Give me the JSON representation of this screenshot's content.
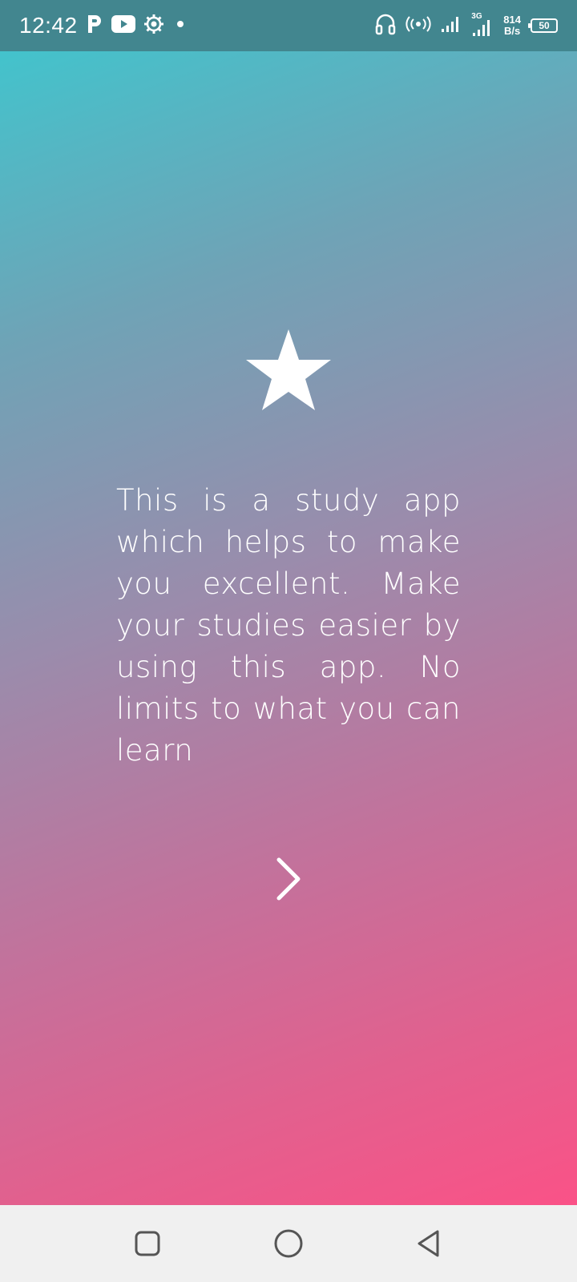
{
  "status_bar": {
    "time": "12:42",
    "network_speed_value": "814",
    "network_speed_unit": "B/s",
    "network_type": "3G",
    "battery_level": "50",
    "icons": [
      "parking-icon",
      "youtube-icon",
      "settings-gear-icon",
      "dot-icon",
      "headphones-icon",
      "hotspot-icon",
      "signal-icon",
      "signal-3g-icon",
      "battery-icon"
    ]
  },
  "intro": {
    "icon": "star-icon",
    "description": "This is a study app which helps to make you excellent. Make your studies easier by using this app. No limits to what you can learn"
  },
  "navigation": {
    "next_icon": "chevron-right-icon"
  },
  "system_nav": {
    "items": [
      "recents-button",
      "home-button",
      "back-button"
    ]
  },
  "colors": {
    "status_bar_bg": "#42868f",
    "gradient_top": "#43c3cc",
    "gradient_bottom": "#fa5287",
    "text": "#ffffff",
    "nav_bar_bg": "#f0f0f0",
    "nav_icon": "#555555"
  }
}
